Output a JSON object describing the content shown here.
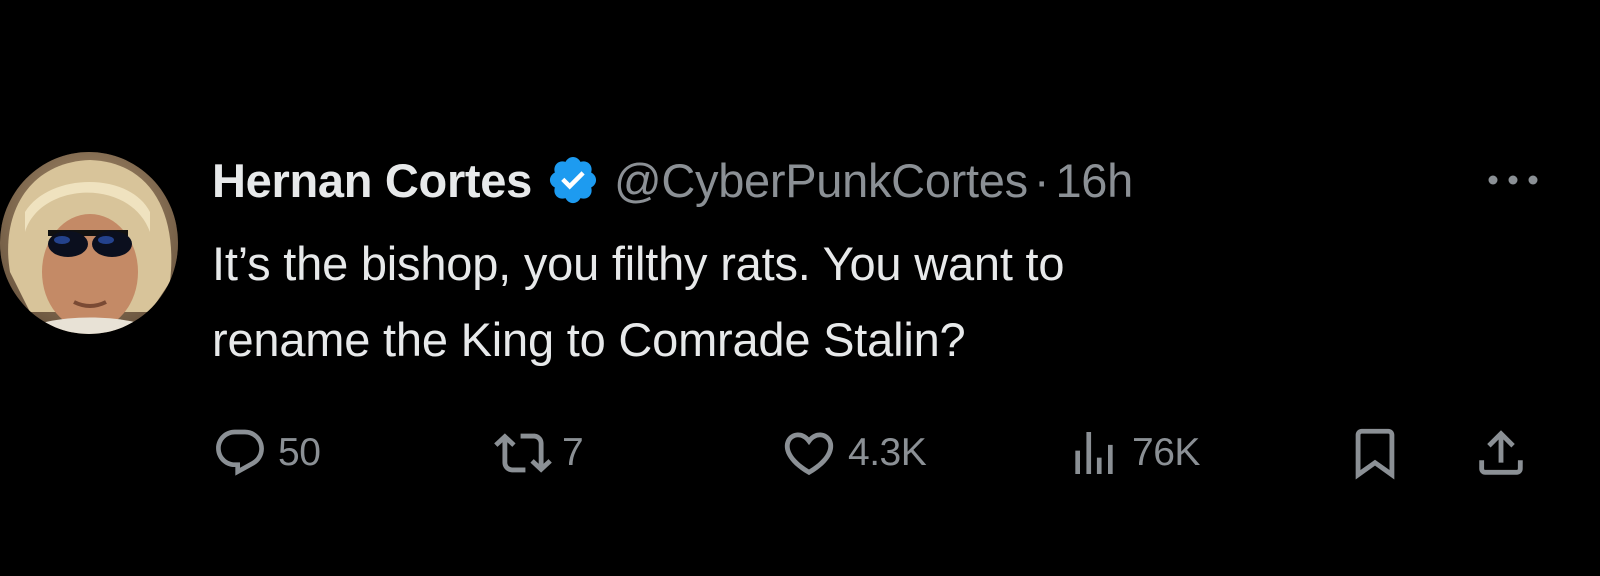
{
  "tweet": {
    "display_name": "Hernan Cortes",
    "handle": "@CyberPunkCortes",
    "separator": "·",
    "time": "16h",
    "verified": true,
    "text_lines": [
      "It’s the bishop, you filthy rats. You want to",
      "rename the King to Comrade Stalin?"
    ]
  },
  "actions": {
    "replies": "50",
    "reposts": "7",
    "likes": "4.3K",
    "views": "76K"
  },
  "icons": {
    "avatar": "avatar",
    "verified": "verified-badge-icon",
    "more": "more-options-icon",
    "reply": "reply-icon",
    "repost": "repost-icon",
    "like": "heart-icon",
    "views": "views-chart-icon",
    "bookmark": "bookmark-icon",
    "share": "share-icon"
  },
  "colors": {
    "background": "#000000",
    "text_primary": "#e7e9ea",
    "text_secondary": "#8b9095",
    "verified_blue": "#1d9bf0"
  }
}
